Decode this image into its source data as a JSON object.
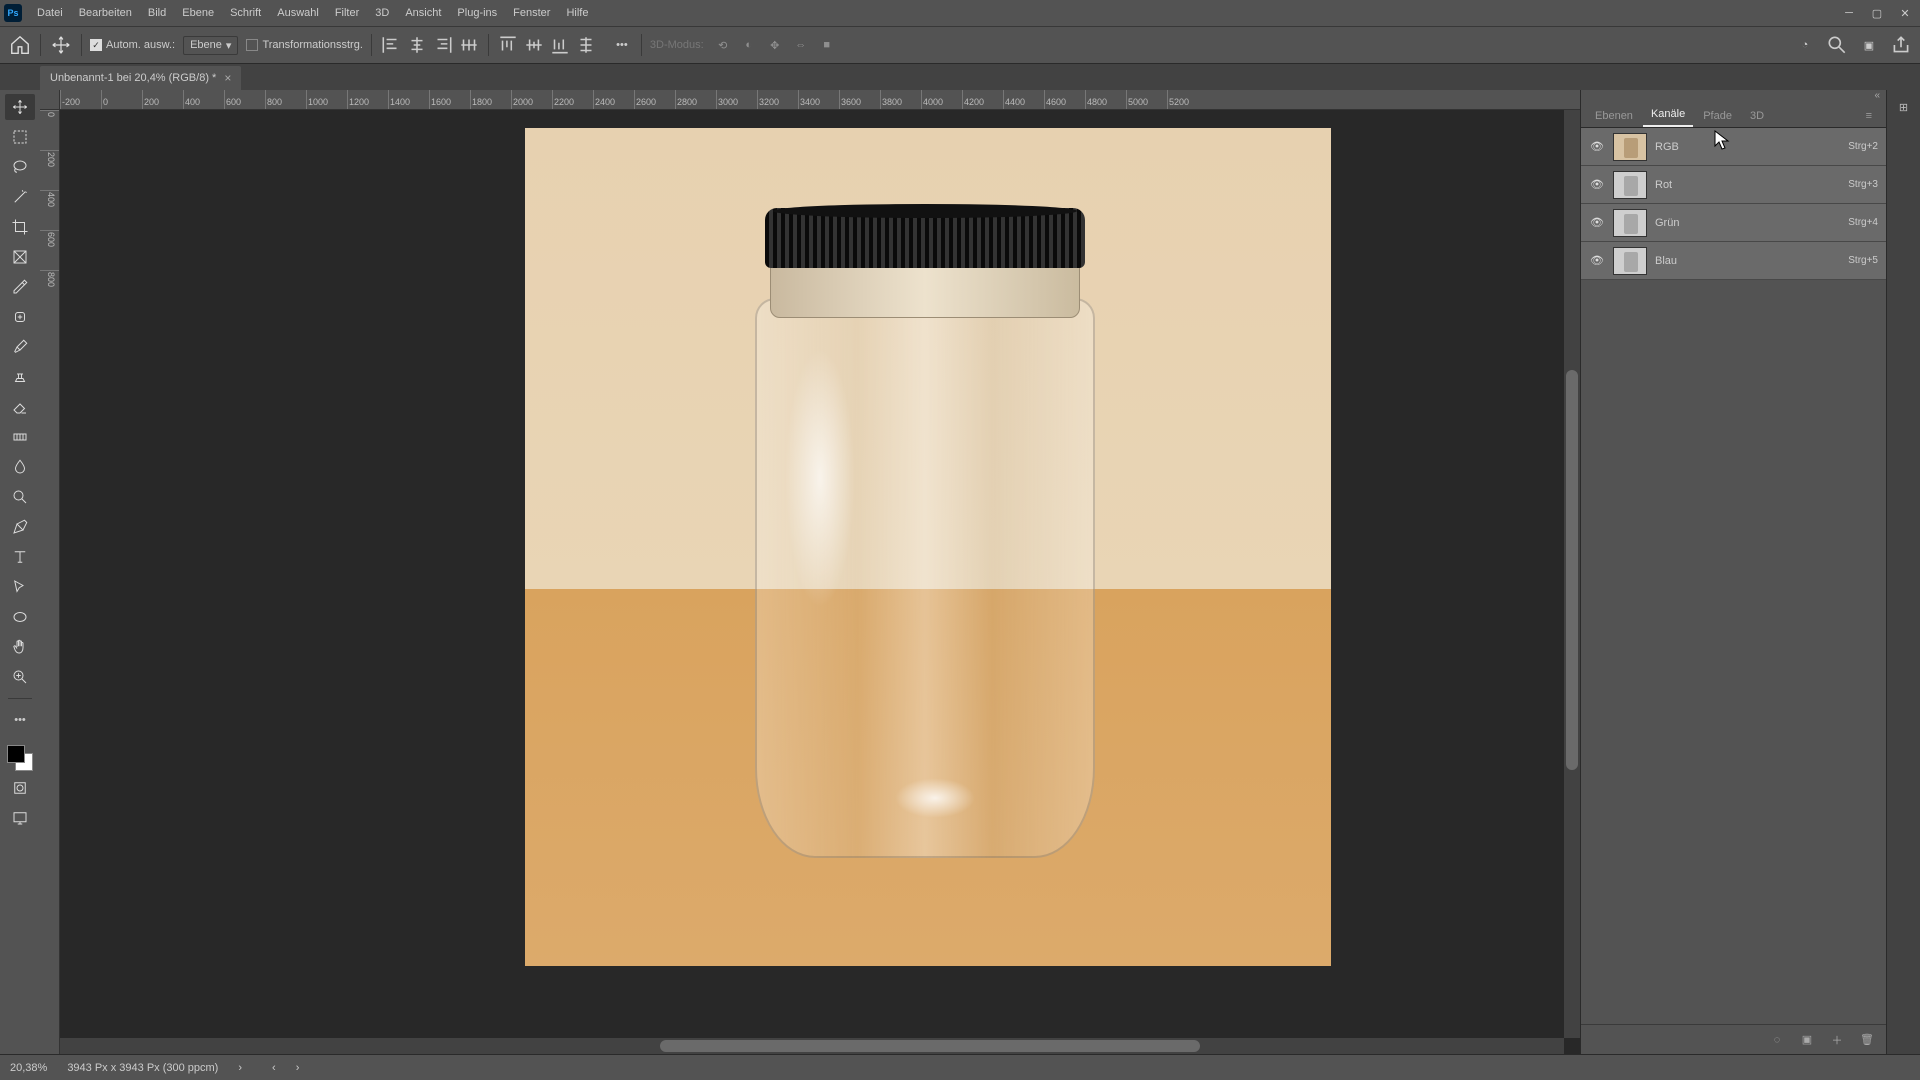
{
  "app": {
    "name": "Ps"
  },
  "menu": [
    "Datei",
    "Bearbeiten",
    "Bild",
    "Ebene",
    "Schrift",
    "Auswahl",
    "Filter",
    "3D",
    "Ansicht",
    "Plug-ins",
    "Fenster",
    "Hilfe"
  ],
  "options": {
    "auto_select_label": "Autom. ausw.:",
    "layer_select": "Ebene",
    "transform_label": "Transformationsstrg.",
    "mode3d_label": "3D-Modus:"
  },
  "document": {
    "tab_title": "Unbenannt-1 bei 20,4% (RGB/8) *"
  },
  "ruler_h": [
    "-200",
    "0",
    "200",
    "400",
    "600",
    "800",
    "1000",
    "1200",
    "1400",
    "1600",
    "1800",
    "2000",
    "2200",
    "2400",
    "2600",
    "2800",
    "3000",
    "3200",
    "3400",
    "3600",
    "3800",
    "4000",
    "4200",
    "4400",
    "4600",
    "4800",
    "5000",
    "5200"
  ],
  "ruler_v": [
    "0",
    "200",
    "400",
    "600",
    "800"
  ],
  "panel": {
    "tabs": {
      "ebenen": "Ebenen",
      "kanaele": "Kanäle",
      "pfade": "Pfade",
      "d3": "3D"
    },
    "channels": [
      {
        "name": "RGB",
        "shortcut": "Strg+2",
        "color": true,
        "selected": true
      },
      {
        "name": "Rot",
        "shortcut": "Strg+3",
        "color": false,
        "selected": true
      },
      {
        "name": "Grün",
        "shortcut": "Strg+4",
        "color": false,
        "selected": true
      },
      {
        "name": "Blau",
        "shortcut": "Strg+5",
        "color": false,
        "selected": true
      }
    ]
  },
  "status": {
    "zoom": "20,38%",
    "doc_info": "3943 Px x 3943 Px (300 ppcm)"
  }
}
